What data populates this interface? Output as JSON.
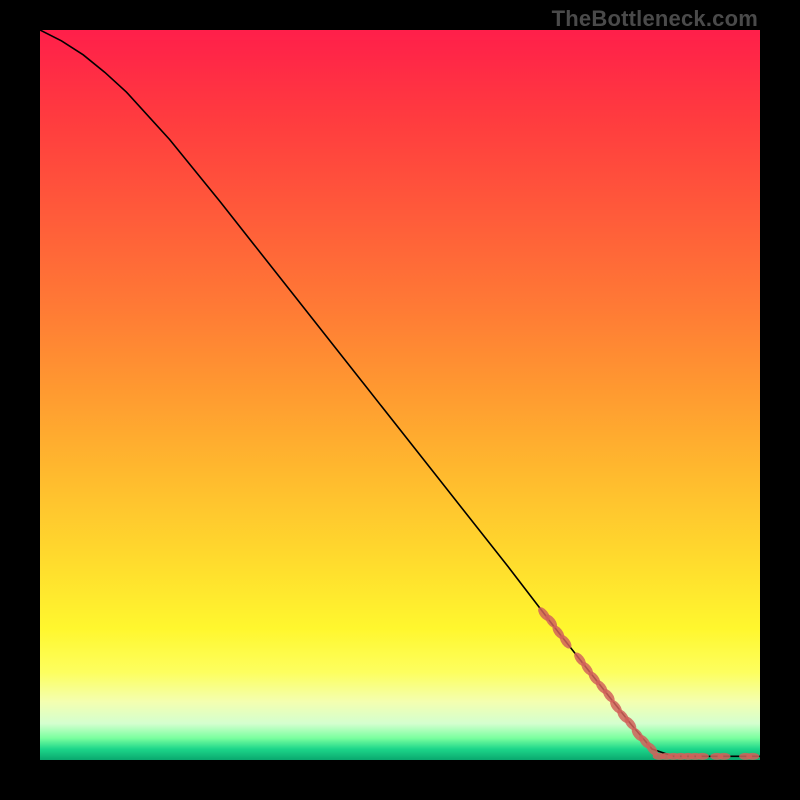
{
  "watermark": "TheBottleneck.com",
  "chart_data": {
    "type": "line",
    "title": "",
    "xlabel": "",
    "ylabel": "",
    "xlim": [
      0,
      100
    ],
    "ylim": [
      0,
      100
    ],
    "grid": false,
    "line_color": "#000000",
    "marker_color": "#d1615a",
    "curve": [
      {
        "x": 0,
        "y": 100
      },
      {
        "x": 3,
        "y": 98.5
      },
      {
        "x": 6,
        "y": 96.6
      },
      {
        "x": 9,
        "y": 94.2
      },
      {
        "x": 12,
        "y": 91.5
      },
      {
        "x": 18,
        "y": 85.0
      },
      {
        "x": 25,
        "y": 76.5
      },
      {
        "x": 35,
        "y": 64.0
      },
      {
        "x": 45,
        "y": 51.5
      },
      {
        "x": 55,
        "y": 39.0
      },
      {
        "x": 65,
        "y": 26.5
      },
      {
        "x": 72,
        "y": 17.5
      },
      {
        "x": 78,
        "y": 10.0
      },
      {
        "x": 82,
        "y": 5.0
      },
      {
        "x": 85,
        "y": 1.5
      },
      {
        "x": 88,
        "y": 0.5
      },
      {
        "x": 92,
        "y": 0.5
      },
      {
        "x": 96,
        "y": 0.5
      },
      {
        "x": 100,
        "y": 0.5
      }
    ],
    "marker_points": [
      {
        "x": 70,
        "y": 20.0
      },
      {
        "x": 71,
        "y": 19.0
      },
      {
        "x": 72,
        "y": 17.5
      },
      {
        "x": 73,
        "y": 16.2
      },
      {
        "x": 75,
        "y": 13.8
      },
      {
        "x": 76,
        "y": 12.5
      },
      {
        "x": 77,
        "y": 11.2
      },
      {
        "x": 78,
        "y": 10.0
      },
      {
        "x": 79,
        "y": 8.8
      },
      {
        "x": 80,
        "y": 7.3
      },
      {
        "x": 81,
        "y": 6.0
      },
      {
        "x": 82,
        "y": 5.0
      },
      {
        "x": 83,
        "y": 3.5
      },
      {
        "x": 84,
        "y": 2.5
      },
      {
        "x": 85,
        "y": 1.5
      },
      {
        "x": 86,
        "y": 0.5
      },
      {
        "x": 87,
        "y": 0.5
      },
      {
        "x": 88,
        "y": 0.5
      },
      {
        "x": 89,
        "y": 0.5
      },
      {
        "x": 90,
        "y": 0.5
      },
      {
        "x": 91,
        "y": 0.5
      },
      {
        "x": 92,
        "y": 0.5
      },
      {
        "x": 94,
        "y": 0.5
      },
      {
        "x": 95,
        "y": 0.5
      },
      {
        "x": 98,
        "y": 0.5
      },
      {
        "x": 99,
        "y": 0.5
      }
    ],
    "gradient_stops": [
      {
        "offset": 0.0,
        "color": "#ff1f4a"
      },
      {
        "offset": 0.12,
        "color": "#ff3b3f"
      },
      {
        "offset": 0.25,
        "color": "#ff5a3a"
      },
      {
        "offset": 0.38,
        "color": "#ff7a35"
      },
      {
        "offset": 0.5,
        "color": "#ff9b30"
      },
      {
        "offset": 0.62,
        "color": "#ffbd2e"
      },
      {
        "offset": 0.72,
        "color": "#ffd92d"
      },
      {
        "offset": 0.82,
        "color": "#fff72e"
      },
      {
        "offset": 0.88,
        "color": "#fdff5f"
      },
      {
        "offset": 0.92,
        "color": "#f4ffb0"
      },
      {
        "offset": 0.95,
        "color": "#d4ffcf"
      },
      {
        "offset": 0.97,
        "color": "#7aff9f"
      },
      {
        "offset": 0.985,
        "color": "#1dd68a"
      },
      {
        "offset": 1.0,
        "color": "#0aa86e"
      }
    ]
  }
}
